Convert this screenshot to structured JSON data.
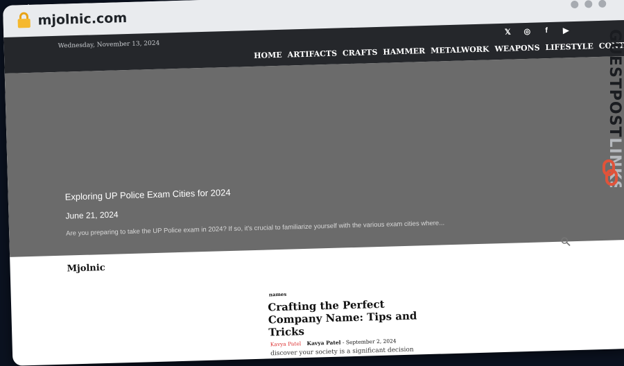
{
  "browser": {
    "url": "mjolnic.com",
    "icons": [
      "lock-icon",
      "window-control-dot",
      "window-control-dot",
      "window-control-dot"
    ]
  },
  "header": {
    "date": "Wednesday, November 13, 2024",
    "social": {
      "x": "𝕏",
      "instagram": "◎",
      "facebook": "f",
      "youtube": "▶"
    },
    "nav": [
      "HOME",
      "ARTIFACTS",
      "CRAFTS",
      "HAMMER",
      "METALWORK",
      "WEAPONS",
      "LIFESTYLE",
      "CONTACT"
    ]
  },
  "hero": {
    "title": "Exploring UP Police Exam Cities for 2024",
    "date": "June 21, 2024",
    "excerpt": "Are you preparing to take the UP Police exam in 2024? If so, it's crucial to familiarize yourself with the various exam cities where..."
  },
  "site": {
    "brand": "Mjolnic"
  },
  "card": {
    "category": "names",
    "title": "Crafting the Perfect Company Name: Tips and Tricks",
    "author_img_alt": "Kavya Patel",
    "author": "Kavya Patel",
    "separator": "-",
    "date": "September 2, 2024",
    "excerpt": "discover your society is a significant decision"
  },
  "watermark": {
    "text": "GUESTPOSTLINKS"
  },
  "colors": {
    "background": "#0b1220",
    "chrome": "#e9ebee",
    "topbar": "#25272b",
    "hero": "#6b6b6b",
    "watermark": "#e0533a"
  }
}
